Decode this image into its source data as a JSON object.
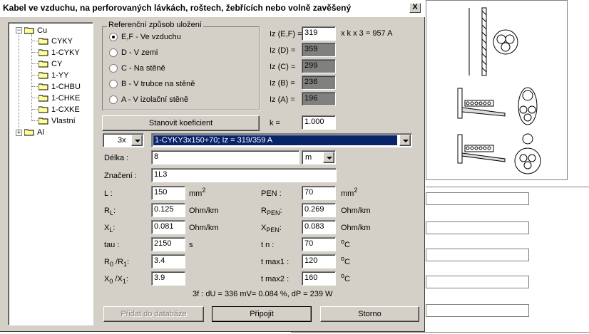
{
  "window": {
    "title": "Kabel ve vzduchu, na perforovaných lávkách, roštech, žebřících nebo volně zavěšený",
    "close_label": "X"
  },
  "tree": {
    "root_cu": "Cu",
    "items": [
      "CYKY",
      "1-CYKY",
      "CY",
      "1-YY",
      "1-CHBU",
      "1-CHKE",
      "1-CXKE",
      "Vlastní"
    ],
    "root_al": "Al",
    "collapse_sign": "−",
    "expand_sign": "+"
  },
  "method_group": {
    "title": "Referenční způsob uložení",
    "options": [
      "E,F - Ve vzduchu",
      "D - V zemi",
      "C - Na stěně",
      "B - V trubce na stěně",
      "A - V izolační stěně"
    ],
    "selected": 0
  },
  "currents": [
    {
      "label": "Iz (E,F) =",
      "value": "319"
    },
    {
      "label": "Iz (D) =",
      "value": "359"
    },
    {
      "label": "Iz (C) =",
      "value": "299"
    },
    {
      "label": "Iz (B) =",
      "value": "236"
    },
    {
      "label": "Iz (A) =",
      "value": "196"
    }
  ],
  "current_note": "x k x 3 = 957 A",
  "coef": {
    "button": "Stanovit koeficient",
    "label": "k =",
    "value": "1.000"
  },
  "count_select": "3x",
  "cable_select": "1-CYKY3x150+70; Iz = 319/359 A",
  "length": {
    "label": "Délka :",
    "value": "8",
    "unit": "m"
  },
  "marking": {
    "label": "Značení :",
    "value": "1L3"
  },
  "params_left": [
    {
      "label": "L :",
      "sub": "",
      "value": "150",
      "unit": "mm",
      "unit_sup": "2"
    },
    {
      "label": "R",
      "sub": "L",
      "value": "0.125",
      "unit": "Ohm/km",
      "unit_sup": ""
    },
    {
      "label": "X",
      "sub": "L",
      "value": "0.081",
      "unit": "Ohm/km",
      "unit_sup": ""
    },
    {
      "label": "tau :",
      "sub": "",
      "value": "2150",
      "unit": "s",
      "unit_sup": ""
    },
    {
      "label": "R",
      "sub": "0",
      "value": "3.4",
      "unit": "",
      "unit_sup": ""
    },
    {
      "label": "X",
      "sub": "0",
      "value": "3.9",
      "unit": "",
      "unit_sup": ""
    }
  ],
  "ratio_parts": {
    "r_mid": " /R",
    "r_sub": "1",
    "x_mid": " /X",
    "x_sub": "1",
    "colon": ":"
  },
  "params_right": [
    {
      "label": "PEN :",
      "sub": "",
      "value": "70",
      "unit": "mm",
      "unit_sup": "2"
    },
    {
      "label": "R",
      "sub": "PEN",
      "value": "0.269",
      "unit": "Ohm/km",
      "unit_sup": ""
    },
    {
      "label": "X",
      "sub": "PEN",
      "value": "0.083",
      "unit": "Ohm/km",
      "unit_sup": ""
    },
    {
      "label": "t n :",
      "sub": "",
      "value": "70",
      "unit": "C",
      "unit_sup": "o"
    },
    {
      "label": "t max1 :",
      "sub": "",
      "value": "120",
      "unit": "C",
      "unit_sup": "o"
    },
    {
      "label": "t max2 :",
      "sub": "",
      "value": "160",
      "unit": "C",
      "unit_sup": "o"
    }
  ],
  "summary": "3f : dU = 336 mV= 0.084 %, dP = 239 W",
  "buttons": {
    "add": "Přidat do databáze",
    "connect": "Připojit",
    "cancel": "Storno"
  }
}
